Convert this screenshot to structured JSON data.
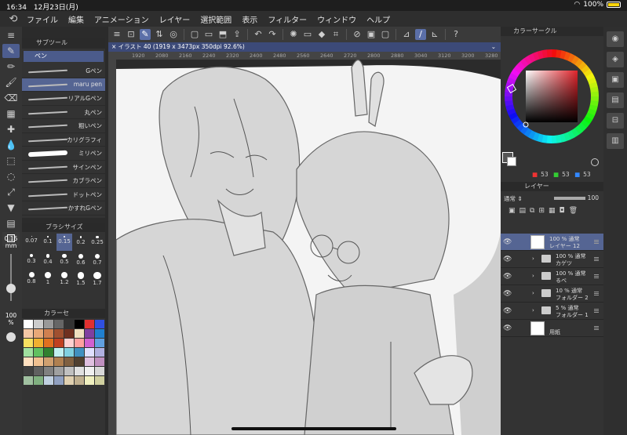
{
  "status": {
    "time": "16:34",
    "date": "12月23日(月)",
    "battery": "100%"
  },
  "menu": [
    "ファイル",
    "編集",
    "アニメーション",
    "レイヤー",
    "選択範囲",
    "表示",
    "フィルター",
    "ウィンドウ",
    "ヘルプ"
  ],
  "subtool": {
    "title": "サブツール",
    "tab": "ペン",
    "brushes": [
      {
        "label": "Gペン"
      },
      {
        "label": "maru pen",
        "selected": true
      },
      {
        "label": "リアルGペン"
      },
      {
        "label": "丸ペン"
      },
      {
        "label": "粗いペン"
      },
      {
        "label": "カリグラフィ"
      },
      {
        "label": "ミリペン",
        "thick": true
      },
      {
        "label": "サインペン"
      },
      {
        "label": "カブラペン"
      },
      {
        "label": "ドットペン"
      },
      {
        "label": "かすれGペン"
      }
    ]
  },
  "brushsize": {
    "title": "ブラシサイズ",
    "values": [
      "0.07",
      "0.1",
      "0.15",
      "0.2",
      "0.25",
      "0.3",
      "0.4",
      "0.5",
      "0.6",
      "0.7",
      "0.8",
      "1",
      "1.2",
      "1.5",
      "1.7"
    ],
    "selected": "0.15",
    "current_size": "0.15",
    "size_unit": "mm",
    "opacity": "100",
    "opacity_unit": "%"
  },
  "palette": {
    "title": "カラーセ"
  },
  "canvas": {
    "tab": "イラスト 40 (1919 x 3473px 350dpi 92.6%)",
    "ruler": [
      "1920",
      "2080",
      "2160",
      "2240",
      "2320",
      "2400",
      "2480",
      "2560",
      "2640",
      "2720",
      "2800",
      "2880",
      "3040",
      "3120",
      "3200",
      "3280"
    ]
  },
  "color_circle": {
    "title": "カラーサークル",
    "r": "53",
    "g": "53",
    "b": "53"
  },
  "layer_panel": {
    "title": "レイヤー",
    "blend": "通常",
    "opacity": "100",
    "layers": [
      {
        "opacity": "100 % 通常",
        "name": "レイヤー 12",
        "type": "layer",
        "selected": true
      },
      {
        "opacity": "100 % 通常",
        "name": "カゲツ",
        "type": "folder"
      },
      {
        "opacity": "100 % 通常",
        "name": "るべ",
        "type": "folder"
      },
      {
        "opacity": "10 % 通常",
        "name": "フォルダー 2",
        "type": "folder"
      },
      {
        "opacity": "5 % 通常",
        "name": "フォルダー 1",
        "type": "folder"
      },
      {
        "opacity": "",
        "name": "用紙",
        "type": "paper"
      }
    ]
  },
  "colors": {
    "accent": "#556593",
    "tab_active": "#3c4a78"
  }
}
